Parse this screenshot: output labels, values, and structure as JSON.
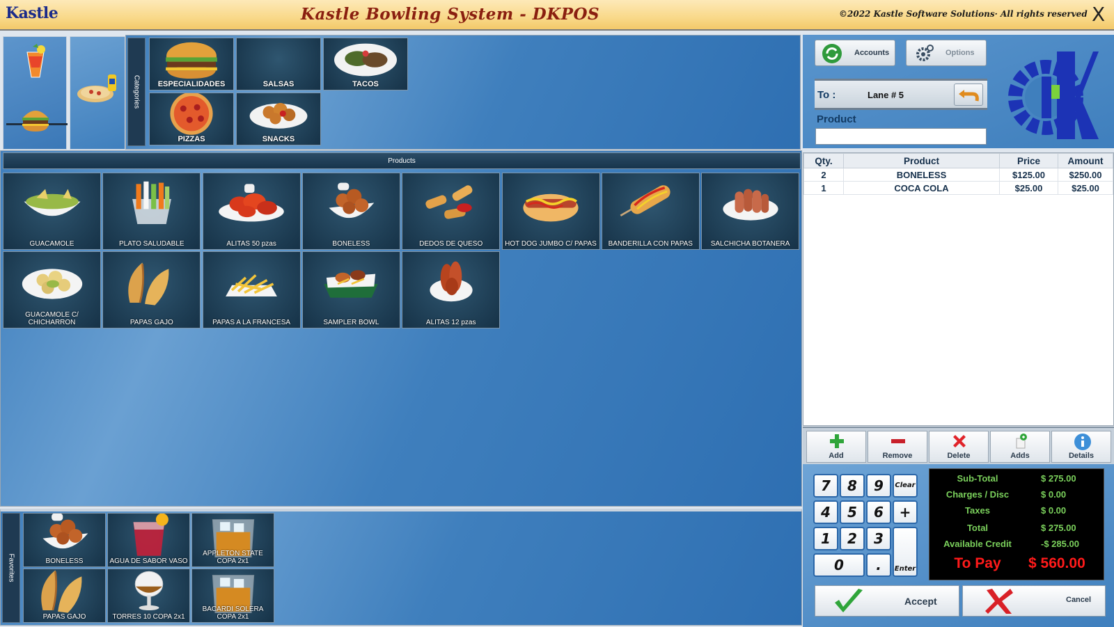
{
  "titlebar": {
    "logo": "Kastle",
    "title": "Kastle Bowling System - DKPOS",
    "copyright": "©2022 Kastle Software Solutions· All rights reserved",
    "close": "X"
  },
  "categories": {
    "tab_label": "Categories",
    "items": [
      {
        "label": "ESPECIALIDADES",
        "icon": "burger"
      },
      {
        "label": "SALSAS",
        "icon": ""
      },
      {
        "label": "TACOS",
        "icon": "tacos"
      },
      {
        "label": "PIZZAS",
        "icon": "pizza"
      },
      {
        "label": "SNACKS",
        "icon": "fried"
      }
    ]
  },
  "products": {
    "header": "Products",
    "items": [
      {
        "label": "GUACAMOLE",
        "icon": "bowl-green"
      },
      {
        "label": "PLATO SALUDABLE",
        "icon": "veggies"
      },
      {
        "label": "ALITAS 50 pzas",
        "icon": "wings"
      },
      {
        "label": "BONELESS",
        "icon": "boneless"
      },
      {
        "label": "DEDOS DE QUESO",
        "icon": "cheese-sticks"
      },
      {
        "label": "HOT DOG JUMBO C/ PAPAS",
        "icon": "hotdog"
      },
      {
        "label": "BANDERILLA CON PAPAS",
        "icon": "corndog"
      },
      {
        "label": "SALCHICHA BOTANERA",
        "icon": "sausage"
      },
      {
        "label": "GUACAMOLE C/ CHICHARRON",
        "icon": "bowl-chicharron"
      },
      {
        "label": "PAPAS GAJO",
        "icon": "wedges"
      },
      {
        "label": "PAPAS A LA FRANCESA",
        "icon": "fries"
      },
      {
        "label": "SAMPLER BOWL",
        "icon": "sampler"
      },
      {
        "label": "ALITAS 12 pzas",
        "icon": "wings-plate"
      }
    ]
  },
  "favorites": {
    "tab_label": "Favorites",
    "items": [
      {
        "label": "BONELESS",
        "icon": "boneless"
      },
      {
        "label": "AGUA DE SABOR VASO",
        "icon": "drink-red"
      },
      {
        "label": "APPLETON STATE COPA 2x1",
        "icon": "whisky"
      },
      {
        "label": "PAPAS GAJO",
        "icon": "wedges"
      },
      {
        "label": "TORRES 10 COPA 2x1",
        "icon": "brandy"
      },
      {
        "label": "BACARDI SOLERA COPA 2x1",
        "icon": "whisky"
      }
    ]
  },
  "right": {
    "accounts": "Accounts",
    "options": "Options",
    "to_label": "To :",
    "lane": "Lane # 5",
    "product_label": "Product",
    "product_value": ""
  },
  "order": {
    "columns": [
      "Qty.",
      "Product",
      "Price",
      "Amount"
    ],
    "rows": [
      {
        "qty": "2",
        "product": "BONELESS",
        "price": "$125.00",
        "amount": "$250.00"
      },
      {
        "qty": "1",
        "product": "COCA COLA",
        "price": "$25.00",
        "amount": "$25.00"
      }
    ]
  },
  "actions": {
    "add": "Add",
    "remove": "Remove",
    "delete": "Delete",
    "adds": "Adds",
    "details": "Details"
  },
  "keypad": {
    "keys": [
      "7",
      "8",
      "9",
      "Clear",
      "4",
      "5",
      "6",
      "+",
      "1",
      "2",
      "3",
      "0",
      ".",
      "Enter"
    ]
  },
  "totals": {
    "subtotal_label": "Sub-Total",
    "subtotal": "$ 275.00",
    "charges_label": "Charges / Disc",
    "charges": "$ 0.00",
    "taxes_label": "Taxes",
    "taxes": "$ 0.00",
    "total_label": "Total",
    "total": "$ 275.00",
    "credit_label": "Available Credit",
    "credit": "-$ 285.00",
    "topay_label": "To Pay",
    "topay": "$ 560.00"
  },
  "buttons": {
    "accept": "Accept",
    "cancel": "Cancel"
  },
  "colors": {
    "panel_blue": "#3f7fbd",
    "tile_dark": "#1d3f58",
    "title_red": "#8a1f10",
    "totals_green": "#7bd15c",
    "topay_red": "#ff1a1a"
  }
}
